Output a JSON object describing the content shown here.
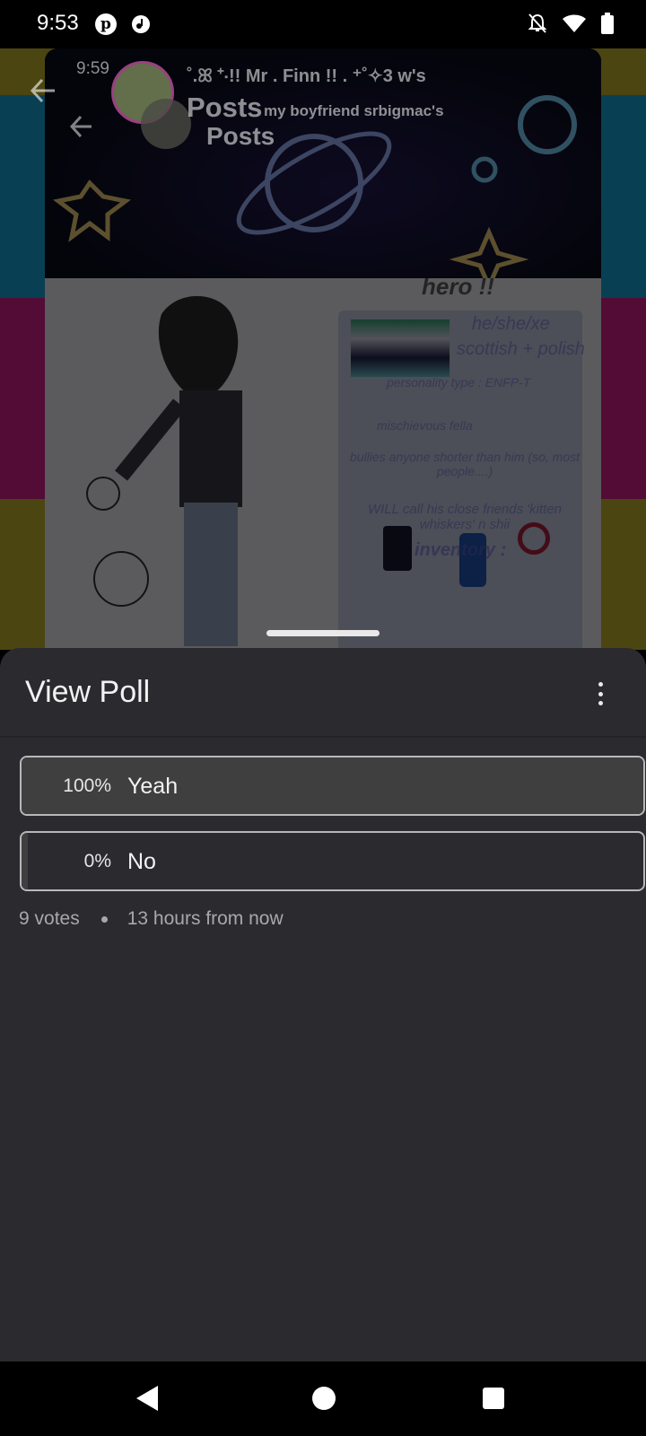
{
  "status_bar": {
    "time": "9:53",
    "icons": [
      "pinterest-icon",
      "music-note-icon",
      "notifications-off-icon",
      "wifi-icon",
      "battery-icon"
    ]
  },
  "background_post": {
    "inner_time": "9:59",
    "profile_line": "˚.ꕤ ⁺‧!! Mr . Finn !! . ⁺˚✧3 w's",
    "title": "Posts",
    "title_repeat": "Posts",
    "subtitle": "my boyfriend srbigmac's",
    "drawing_heading": "hero !!",
    "drawing_lines": [
      "he/she/xe",
      "scottish + polish",
      "personality type : ENFP-T",
      "mischievous fella",
      "bullies anyone shorter than him (so, most people....)",
      "WILL call his close friends 'kitten whiskers' n shii",
      "inventory :"
    ],
    "colors": {
      "stripe_yellow": "#c4b52d",
      "stripe_cyan": "#1aa6d8",
      "stripe_pink": "#d7208c"
    }
  },
  "sheet": {
    "title": "View Poll",
    "options": [
      {
        "percent_text": "100%",
        "label": "Yeah",
        "fraction": 1.0
      },
      {
        "percent_text": "0%",
        "label": "No",
        "fraction": 0.0
      }
    ],
    "votes": "9 votes",
    "time_left": "13 hours from now"
  },
  "nav_bar": {
    "icons": [
      "back-icon",
      "home-icon",
      "recents-icon"
    ]
  }
}
